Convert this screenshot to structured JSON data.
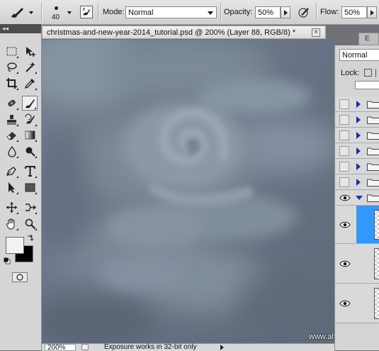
{
  "options_bar": {
    "brush_size": "40",
    "mode_label": "Mode:",
    "mode_value": "Normal",
    "opacity_label": "Opacity:",
    "opacity_value": "50%",
    "flow_label": "Flow:",
    "flow_value": "50%"
  },
  "toolbox": {
    "collapse_glyph": "◂◂",
    "tools": [
      "marquee-icon",
      "move-icon",
      "lasso-icon",
      "magic-wand-icon",
      "crop-icon",
      "eyedropper-icon",
      "spot-healing-icon",
      "brush-icon",
      "clone-stamp-icon",
      "history-brush-icon",
      "eraser-icon",
      "gradient-icon",
      "blur-icon",
      "dodge-icon",
      "pen-icon",
      "type-icon",
      "path-selection-icon",
      "rectangle-shape-icon",
      "3d-rotate-icon",
      "3d-orbit-icon",
      "hand-icon",
      "zoom-icon"
    ],
    "active_tool": "brush-icon",
    "foreground_color": "#f2f2f2",
    "background_color": "#000000"
  },
  "document": {
    "title": "christmas-and-new-year-2014_tutorial.psd @ 200% (Layer 88, RGB/8) *",
    "close_glyph": "×",
    "zoom": "200%",
    "status": "Exposure works in 32-bit only",
    "watermark": "www.alfoart.com"
  },
  "layers_panel": {
    "blend_mode": "Normal",
    "lock_label": "Lock:",
    "tab_glyph": "E",
    "rows": [
      {
        "type": "group",
        "visible": false
      },
      {
        "type": "group",
        "visible": false
      },
      {
        "type": "group",
        "visible": false
      },
      {
        "type": "group",
        "visible": false
      },
      {
        "type": "group",
        "visible": false
      },
      {
        "type": "group",
        "visible": false
      },
      {
        "type": "group-open",
        "visible": true
      },
      {
        "type": "layer",
        "visible": true,
        "selected": true
      },
      {
        "type": "layer",
        "visible": true
      },
      {
        "type": "layer",
        "visible": true
      }
    ]
  },
  "colors": {
    "selection": "#3399ff",
    "canvas_base": "#687585"
  }
}
